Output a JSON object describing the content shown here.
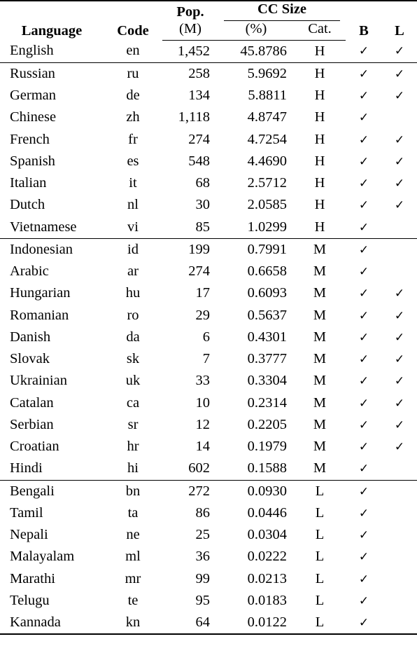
{
  "table": {
    "headers": {
      "language": "Language",
      "code": "Code",
      "pop_main": "Pop.",
      "pop_unit": "(M)",
      "cc_group": "CC Size",
      "cc_pct": "(%)",
      "cc_cat": "Cat.",
      "b": "B",
      "l": "L"
    },
    "check_glyph": "✓",
    "groups": [
      {
        "name": "english-group",
        "rows": [
          {
            "language": "English",
            "code": "en",
            "pop": "1,452",
            "pct": "45.8786",
            "cat": "H",
            "b": "✓",
            "l": "✓"
          }
        ]
      },
      {
        "name": "high-resource-group",
        "rows": [
          {
            "language": "Russian",
            "code": "ru",
            "pop": "258",
            "pct": "5.9692",
            "cat": "H",
            "b": "✓",
            "l": "✓"
          },
          {
            "language": "German",
            "code": "de",
            "pop": "134",
            "pct": "5.8811",
            "cat": "H",
            "b": "✓",
            "l": "✓"
          },
          {
            "language": "Chinese",
            "code": "zh",
            "pop": "1,118",
            "pct": "4.8747",
            "cat": "H",
            "b": "✓",
            "l": ""
          },
          {
            "language": "French",
            "code": "fr",
            "pop": "274",
            "pct": "4.7254",
            "cat": "H",
            "b": "✓",
            "l": "✓"
          },
          {
            "language": "Spanish",
            "code": "es",
            "pop": "548",
            "pct": "4.4690",
            "cat": "H",
            "b": "✓",
            "l": "✓"
          },
          {
            "language": "Italian",
            "code": "it",
            "pop": "68",
            "pct": "2.5712",
            "cat": "H",
            "b": "✓",
            "l": "✓"
          },
          {
            "language": "Dutch",
            "code": "nl",
            "pop": "30",
            "pct": "2.0585",
            "cat": "H",
            "b": "✓",
            "l": "✓"
          },
          {
            "language": "Vietnamese",
            "code": "vi",
            "pop": "85",
            "pct": "1.0299",
            "cat": "H",
            "b": "✓",
            "l": ""
          }
        ]
      },
      {
        "name": "medium-resource-group",
        "rows": [
          {
            "language": "Indonesian",
            "code": "id",
            "pop": "199",
            "pct": "0.7991",
            "cat": "M",
            "b": "✓",
            "l": ""
          },
          {
            "language": "Arabic",
            "code": "ar",
            "pop": "274",
            "pct": "0.6658",
            "cat": "M",
            "b": "✓",
            "l": ""
          },
          {
            "language": "Hungarian",
            "code": "hu",
            "pop": "17",
            "pct": "0.6093",
            "cat": "M",
            "b": "✓",
            "l": "✓"
          },
          {
            "language": "Romanian",
            "code": "ro",
            "pop": "29",
            "pct": "0.5637",
            "cat": "M",
            "b": "✓",
            "l": "✓"
          },
          {
            "language": "Danish",
            "code": "da",
            "pop": "6",
            "pct": "0.4301",
            "cat": "M",
            "b": "✓",
            "l": "✓"
          },
          {
            "language": "Slovak",
            "code": "sk",
            "pop": "7",
            "pct": "0.3777",
            "cat": "M",
            "b": "✓",
            "l": "✓"
          },
          {
            "language": "Ukrainian",
            "code": "uk",
            "pop": "33",
            "pct": "0.3304",
            "cat": "M",
            "b": "✓",
            "l": "✓"
          },
          {
            "language": "Catalan",
            "code": "ca",
            "pop": "10",
            "pct": "0.2314",
            "cat": "M",
            "b": "✓",
            "l": "✓"
          },
          {
            "language": "Serbian",
            "code": "sr",
            "pop": "12",
            "pct": "0.2205",
            "cat": "M",
            "b": "✓",
            "l": "✓"
          },
          {
            "language": "Croatian",
            "code": "hr",
            "pop": "14",
            "pct": "0.1979",
            "cat": "M",
            "b": "✓",
            "l": "✓"
          },
          {
            "language": "Hindi",
            "code": "hi",
            "pop": "602",
            "pct": "0.1588",
            "cat": "M",
            "b": "✓",
            "l": ""
          }
        ]
      },
      {
        "name": "low-resource-group",
        "rows": [
          {
            "language": "Bengali",
            "code": "bn",
            "pop": "272",
            "pct": "0.0930",
            "cat": "L",
            "b": "✓",
            "l": ""
          },
          {
            "language": "Tamil",
            "code": "ta",
            "pop": "86",
            "pct": "0.0446",
            "cat": "L",
            "b": "✓",
            "l": ""
          },
          {
            "language": "Nepali",
            "code": "ne",
            "pop": "25",
            "pct": "0.0304",
            "cat": "L",
            "b": "✓",
            "l": ""
          },
          {
            "language": "Malayalam",
            "code": "ml",
            "pop": "36",
            "pct": "0.0222",
            "cat": "L",
            "b": "✓",
            "l": ""
          },
          {
            "language": "Marathi",
            "code": "mr",
            "pop": "99",
            "pct": "0.0213",
            "cat": "L",
            "b": "✓",
            "l": ""
          },
          {
            "language": "Telugu",
            "code": "te",
            "pop": "95",
            "pct": "0.0183",
            "cat": "L",
            "b": "✓",
            "l": ""
          },
          {
            "language": "Kannada",
            "code": "kn",
            "pop": "64",
            "pct": "0.0122",
            "cat": "L",
            "b": "✓",
            "l": ""
          }
        ]
      }
    ]
  }
}
